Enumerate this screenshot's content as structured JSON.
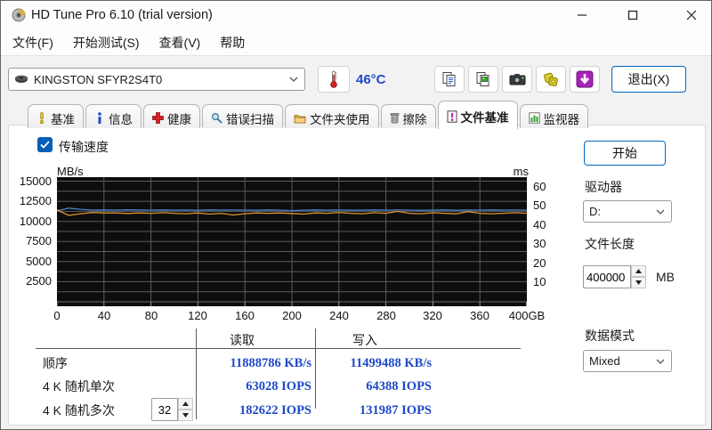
{
  "window": {
    "title": "HD Tune Pro 6.10 (trial version)",
    "controls": {
      "minimize": "minimize",
      "maximize": "maximize",
      "close": "close"
    }
  },
  "menu": {
    "items": [
      "文件(F)",
      "开始测试(S)",
      "查看(V)",
      "帮助"
    ]
  },
  "toolbar": {
    "drive_selector_value": "KINGSTON SFYR2S4T0",
    "temperature": "46°C",
    "buttons": [
      "copy-text-icon",
      "copy-image-icon",
      "screenshot-icon",
      "save-results-icon",
      "download-icon"
    ],
    "exit_label": "退出(X)"
  },
  "tabs": [
    {
      "label": "基准",
      "icon": "benchmark-icon",
      "active": false
    },
    {
      "label": "信息",
      "icon": "info-icon",
      "active": false
    },
    {
      "label": "健康",
      "icon": "health-icon",
      "active": false
    },
    {
      "label": "错误扫描",
      "icon": "error-scan-icon",
      "active": false
    },
    {
      "label": "文件夹使用",
      "icon": "folder-usage-icon",
      "active": false
    },
    {
      "label": "擦除",
      "icon": "erase-icon",
      "active": false
    },
    {
      "label": "文件基准",
      "icon": "file-benchmark-icon",
      "active": true
    },
    {
      "label": "监视器",
      "icon": "monitor-icon",
      "active": false
    }
  ],
  "panel": {
    "transfer_speed_label": "传输速度",
    "start_button": "开始",
    "drive_label": "驱动器",
    "drive_value": "D:",
    "file_length_label": "文件长度",
    "file_length_value": "400000",
    "file_length_unit": "MB",
    "data_mode_label": "数据模式",
    "data_mode_value": "Mixed"
  },
  "results": {
    "columns": [
      "读取",
      "写入"
    ],
    "rows": [
      {
        "label": "顺序",
        "read": "11888786 KB/s",
        "write": "11499488 KB/s"
      },
      {
        "label": "4 K 随机单次",
        "read": "63028 IOPS",
        "write": "64388 IOPS"
      },
      {
        "label": "4 K 随机多次",
        "queue_depth": "32",
        "read": "182622 IOPS",
        "write": "131987 IOPS"
      }
    ]
  },
  "chart_data": {
    "type": "line",
    "title": "",
    "xlabel": "GB",
    "ylabel_left": "MB/s",
    "ylabel_right": "ms",
    "x_range": [
      0,
      400
    ],
    "y_left_range": [
      0,
      15500
    ],
    "y_right_range": [
      0,
      65
    ],
    "grid": true,
    "grid_step_y": 1250,
    "background": "#0d0d0d",
    "x_ticks": [
      "0",
      "40",
      "80",
      "120",
      "160",
      "200",
      "240",
      "280",
      "320",
      "360",
      "400GB"
    ],
    "y_left_ticks": [
      15000,
      12500,
      10000,
      7500,
      5000,
      2500
    ],
    "y_right_ticks": [
      60,
      50,
      40,
      30,
      20,
      10
    ],
    "series": [
      {
        "name": "read_speed_mbs",
        "color": "#4a82c8",
        "x_step": 10,
        "values": [
          11300,
          11650,
          11500,
          11400,
          11430,
          11400,
          11440,
          11420,
          11400,
          11430,
          11400,
          11420,
          11380,
          11430,
          11400,
          11420,
          11400,
          11380,
          11430,
          11400,
          11330,
          11400,
          11430,
          11400,
          11420,
          11380,
          11400,
          11430,
          11400,
          11420,
          11400,
          11370,
          11400,
          11430,
          11380,
          11420,
          11400,
          11430,
          11400,
          11420,
          11400
        ]
      },
      {
        "name": "write_speed_mbs",
        "color": "#d9952f",
        "x_step": 10,
        "values": [
          11450,
          10750,
          10950,
          11100,
          11050,
          11050,
          10980,
          11050,
          11000,
          11080,
          11000,
          10950,
          11050,
          10900,
          11000,
          10800,
          10950,
          11050,
          11000,
          11050,
          10980,
          10900,
          11050,
          11000,
          11120,
          11000,
          10950,
          11080,
          11000,
          11250,
          11000,
          10950,
          11080,
          11000,
          10950,
          11220,
          11000,
          10950,
          11000,
          11080,
          11000
        ]
      }
    ]
  },
  "colors": {
    "accent": "#0067c0",
    "value_text": "#1d49c9",
    "grid_line": "#5c5c5c",
    "download_button": "#a623b8"
  }
}
